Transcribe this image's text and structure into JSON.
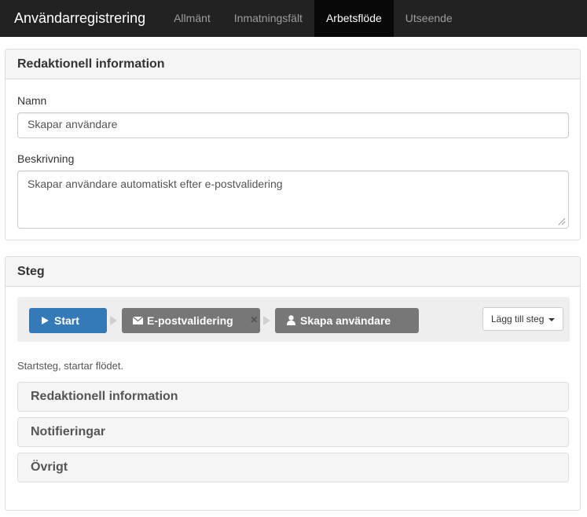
{
  "navbar": {
    "brand": "Användarregistrering",
    "tabs": [
      {
        "label": "Allmänt",
        "active": false
      },
      {
        "label": "Inmatningsfält",
        "active": false
      },
      {
        "label": "Arbetsflöde",
        "active": true
      },
      {
        "label": "Utseende",
        "active": false
      }
    ]
  },
  "editorial_panel": {
    "title": "Redaktionell information",
    "name_label": "Namn",
    "name_value": "Skapar användare",
    "description_label": "Beskrivning",
    "description_value": "Skapar användare automatiskt efter e-postvalidering"
  },
  "steps_panel": {
    "title": "Steg",
    "steps": [
      {
        "label": "Start",
        "icon": "play-icon",
        "selected": true,
        "removable": false
      },
      {
        "label": "E-postvalidering",
        "icon": "envelope-icon",
        "selected": false,
        "removable": true
      },
      {
        "label": "Skapa användare",
        "icon": "user-icon",
        "selected": false,
        "removable": false
      }
    ],
    "remove_symbol": "×",
    "add_step_label": "Lägg till steg",
    "help_text": "Startsteg, startar flödet.",
    "sections": [
      {
        "title": "Redaktionell information"
      },
      {
        "title": "Notifieringar"
      },
      {
        "title": "Övrigt"
      }
    ]
  },
  "colors": {
    "navbar_bg": "#222222",
    "nav_active_bg": "#080808",
    "primary": "#337ab7",
    "step_gray": "#777777",
    "panel_heading_bg": "#f5f5f5",
    "border": "#dddddd"
  }
}
